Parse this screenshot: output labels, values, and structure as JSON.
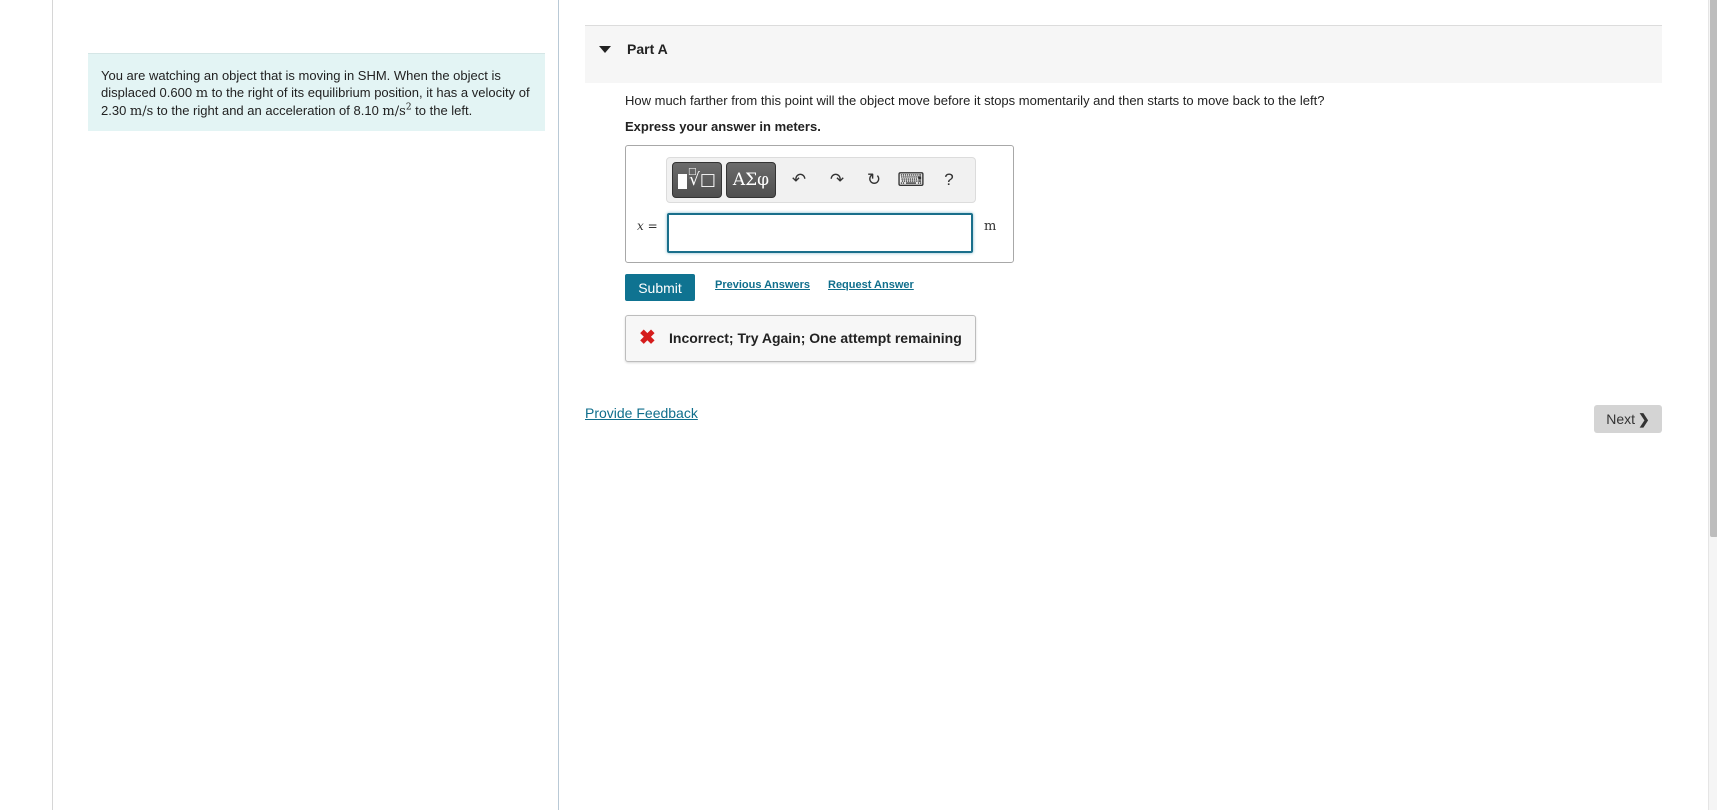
{
  "problem": {
    "text_1": "You are watching an object that is moving in SHM. When the object is displaced 0.600 ",
    "unit_m": "m",
    "text_2": " to the right of its equilibrium position, it has a velocity of 2.30 ",
    "unit_ms": "m/s",
    "text_3": " to the right and an acceleration of 8.10 ",
    "unit_ms2": "m/s",
    "unit_ms2_exp": "2",
    "text_4": " to the left."
  },
  "part": {
    "title": "Part A",
    "question": "How much farther from this point will the object move before it stops momentarily and then starts to move back to the left?",
    "instruction": "Express your answer in meters."
  },
  "toolbar": {
    "templates_root_index": "□",
    "greek_label": "ΑΣφ",
    "undo_glyph": "↶",
    "redo_glyph": "↷",
    "reset_glyph": "↻",
    "keyboard_glyph": "⌨",
    "help_label": "?"
  },
  "answer": {
    "variable_label": "x =",
    "value": "",
    "unit": "m"
  },
  "actions": {
    "submit_label": "Submit",
    "previous_answers_label": "Previous Answers",
    "request_answer_label": "Request Answer"
  },
  "feedback": {
    "icon": "✖",
    "message": "Incorrect; Try Again; One attempt remaining"
  },
  "footer": {
    "provide_feedback_label": "Provide Feedback",
    "next_label": "Next",
    "next_glyph": "❯"
  },
  "colors": {
    "accent": "#0f7391",
    "error": "#d51c1c",
    "problem_bg": "#e3f4f4"
  }
}
